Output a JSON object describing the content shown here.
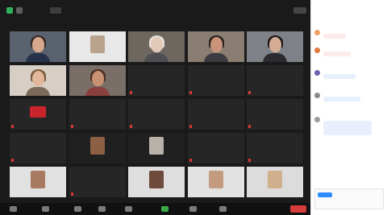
{
  "app": {
    "title": "",
    "accent": "#2d8cff",
    "active_speaker_color": "#8bd043",
    "icons": [
      "shield-icon",
      "info-icon",
      "view-icon",
      "mic-icon",
      "video-icon",
      "participants-icon",
      "chat-icon",
      "share-screen-icon",
      "record-icon",
      "reactions-icon"
    ]
  },
  "grid": {
    "tiles": [
      {
        "kind": "video",
        "name": "",
        "bg": "#5a6270",
        "skin": "#d8a88e",
        "hair": "#3a2c24",
        "shirt": "#26324a"
      },
      {
        "kind": "video",
        "name": "",
        "bg": "#e8e8e8",
        "thumb": "#b9a38c"
      },
      {
        "kind": "video",
        "name": "",
        "bg": "#6d6760",
        "skin": "#e3c9b8",
        "hair": "#e4e2dc",
        "shirt": "#4f4e52"
      },
      {
        "kind": "video",
        "name": "",
        "bg": "#8a7e72",
        "skin": "#c9937a",
        "hair": "#2c2421",
        "shirt": "#3b3b41"
      },
      {
        "kind": "video",
        "name": "",
        "bg": "#7f8188",
        "skin": "#d5ad96",
        "hair": "#1f1a18",
        "shirt": "#2b2b30"
      },
      {
        "kind": "video",
        "name": "",
        "bg": "#d7cfc6",
        "skin": "#e2b79c",
        "hair": "#7a5a40",
        "shirt": "#7d6a5a"
      },
      {
        "kind": "video",
        "name": "",
        "bg": "#7a6f68",
        "skin": "#c99173",
        "hair": "#4a2f24",
        "shirt": "#8a3f3f"
      },
      {
        "kind": "name",
        "name": ""
      },
      {
        "kind": "name",
        "name": ""
      },
      {
        "kind": "name",
        "name": ""
      },
      {
        "kind": "logo",
        "name": "",
        "logo": "#c9242b"
      },
      {
        "kind": "name",
        "name": ""
      },
      {
        "kind": "name",
        "name": ""
      },
      {
        "kind": "name",
        "name": ""
      },
      {
        "kind": "name",
        "name": ""
      },
      {
        "kind": "name",
        "name": ""
      },
      {
        "kind": "video",
        "name": "",
        "bg": "#202020",
        "thumb": "#8d5f43"
      },
      {
        "kind": "video",
        "name": "",
        "bg": "#202020",
        "thumb": "#b8b1a8"
      },
      {
        "kind": "name",
        "name": ""
      },
      {
        "kind": "name",
        "name": ""
      },
      {
        "kind": "video",
        "name": "",
        "bg": "#e1e1e1",
        "thumb": "#a87a62"
      },
      {
        "kind": "name",
        "name": ""
      },
      {
        "kind": "video",
        "name": "",
        "bg": "#dedede",
        "thumb": "#6e4a3a"
      },
      {
        "kind": "video",
        "name": "",
        "bg": "#e2e2e2",
        "thumb": "#c39c80"
      },
      {
        "kind": "video",
        "name": "",
        "bg": "#dcdcdc",
        "thumb": "#d0b08c"
      }
    ]
  },
  "toolbar": {
    "buttons": [
      {
        "icon": "mic-icon",
        "green": false
      },
      {
        "icon": "video-icon",
        "green": false
      },
      {
        "icon": "shield-icon",
        "green": false
      },
      {
        "icon": "participants-icon",
        "green": false
      },
      {
        "icon": "chat-icon",
        "green": false
      },
      {
        "icon": "share-screen-icon",
        "green": true
      },
      {
        "icon": "record-icon",
        "green": false
      },
      {
        "icon": "reactions-icon",
        "green": false
      }
    ],
    "end_color": "#d63c3c"
  },
  "chat": {
    "title": "",
    "subtitle": "",
    "messages": [
      {
        "sender": "",
        "text": "",
        "avatar": "#f0a060",
        "tone": "red"
      },
      {
        "sender": "",
        "text": "",
        "avatar": "#e07a3e",
        "tone": "red"
      },
      {
        "sender": "",
        "text": "",
        "avatar": "#6f5fb0",
        "tone": "blue"
      },
      {
        "sender": "",
        "text": "",
        "avatar": "#8a8a8a",
        "tone": "blue"
      },
      {
        "sender": "",
        "text": "",
        "avatar": "#9a9a9a",
        "tone": "blue"
      }
    ],
    "placeholder": ""
  }
}
